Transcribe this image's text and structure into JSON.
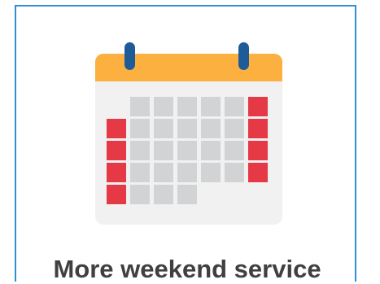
{
  "card": {
    "caption": "More weekend service",
    "border_color": "#2f8fd0"
  },
  "calendar": {
    "icon": "calendar-icon",
    "header_color": "#fbb040",
    "ring_color": "#1d5c96",
    "body_color": "#f1f1f1",
    "day_color": "#d1d3d4",
    "weekend_color": "#e63946"
  }
}
